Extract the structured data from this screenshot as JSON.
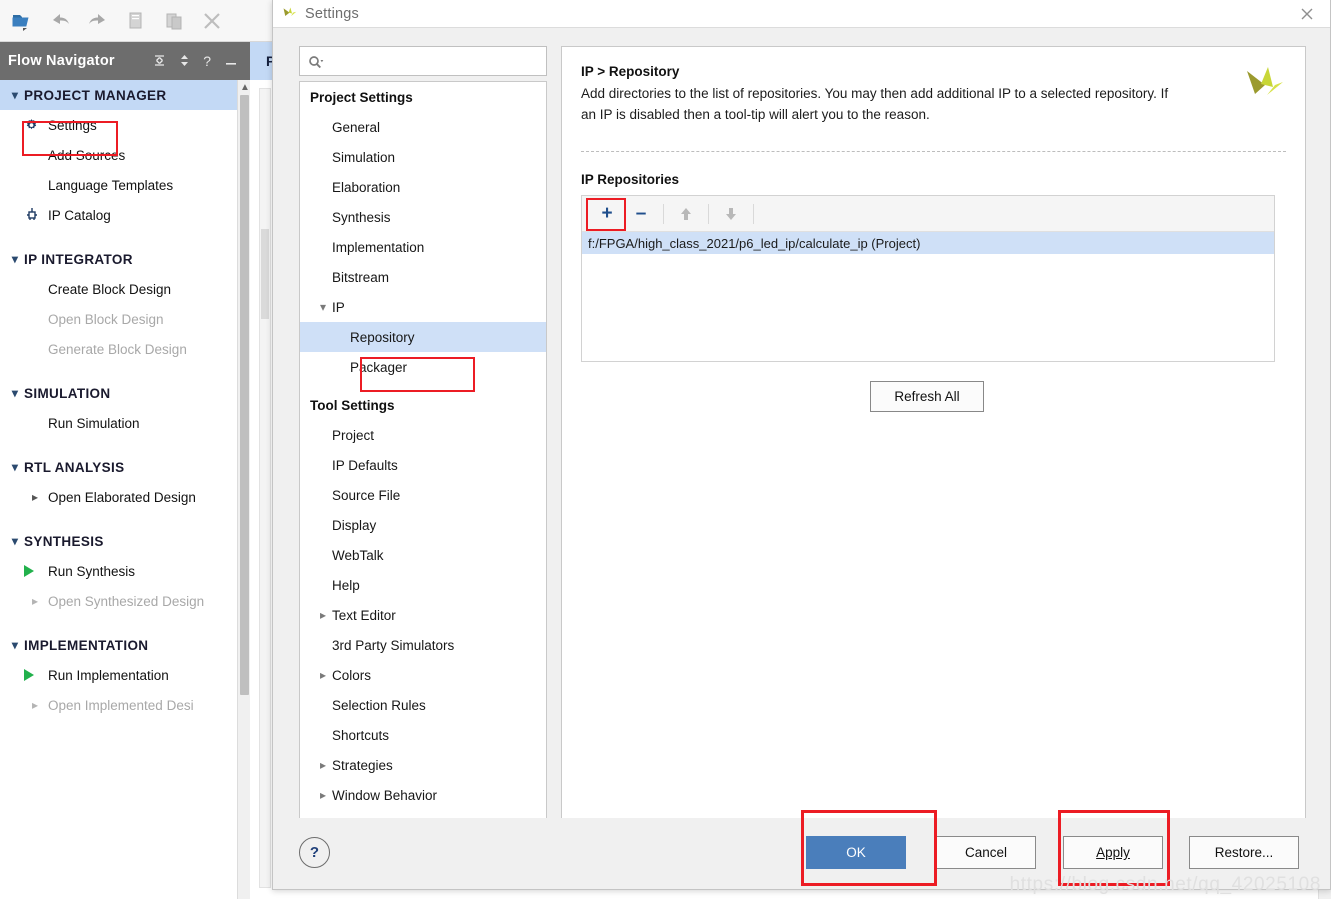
{
  "background": {
    "toolbar_icons": [
      "open-folder-icon",
      "undo-icon",
      "redo-icon",
      "copy-icon",
      "paste-icon",
      "close-icon"
    ],
    "flow_navigator": {
      "title": "Flow Navigator",
      "tools": [
        "collapse-all-icon",
        "expand-icon",
        "help-icon",
        "minimize-icon"
      ],
      "groups": [
        {
          "label": "PROJECT MANAGER",
          "active": true,
          "items": [
            {
              "label": "Settings",
              "icon": "gear-icon",
              "dim": false,
              "highlighted": true
            },
            {
              "label": "Add Sources",
              "icon": "",
              "dim": false
            },
            {
              "label": "Language Templates",
              "icon": "",
              "dim": false
            },
            {
              "label": "IP Catalog",
              "icon": "ip-catalog-icon",
              "dim": false
            }
          ]
        },
        {
          "label": "IP INTEGRATOR",
          "active": false,
          "items": [
            {
              "label": "Create Block Design",
              "icon": "",
              "dim": false
            },
            {
              "label": "Open Block Design",
              "icon": "",
              "dim": true
            },
            {
              "label": "Generate Block Design",
              "icon": "",
              "dim": true
            }
          ]
        },
        {
          "label": "SIMULATION",
          "active": false,
          "items": [
            {
              "label": "Run Simulation",
              "icon": "",
              "dim": false
            }
          ]
        },
        {
          "label": "RTL ANALYSIS",
          "active": false,
          "items": [
            {
              "label": "Open Elaborated Design",
              "icon": "chevron-right-icon",
              "dim": false,
              "arrow": true
            }
          ]
        },
        {
          "label": "SYNTHESIS",
          "active": false,
          "items": [
            {
              "label": "Run Synthesis",
              "icon": "play-icon",
              "dim": false
            },
            {
              "label": "Open Synthesized Design",
              "icon": "chevron-right-icon",
              "dim": true,
              "arrow": true
            }
          ]
        },
        {
          "label": "IMPLEMENTATION",
          "active": false,
          "items": [
            {
              "label": "Run Implementation",
              "icon": "play-icon",
              "dim": false
            },
            {
              "label": "Open Implemented Desi",
              "icon": "chevron-right-icon",
              "dim": true,
              "arrow": true
            }
          ]
        }
      ]
    },
    "panel_header_label": "P"
  },
  "dialog": {
    "title": "Settings",
    "icon": "vivado-logo-icon",
    "close_icon": "close-icon",
    "search": {
      "placeholder": "",
      "value": "",
      "icon": "search-icon"
    },
    "nav": {
      "sections": [
        {
          "header": "Project Settings",
          "items": [
            {
              "label": "General",
              "level": 1,
              "twisty": ""
            },
            {
              "label": "Simulation",
              "level": 1,
              "twisty": ""
            },
            {
              "label": "Elaboration",
              "level": 1,
              "twisty": ""
            },
            {
              "label": "Synthesis",
              "level": 1,
              "twisty": ""
            },
            {
              "label": "Implementation",
              "level": 1,
              "twisty": ""
            },
            {
              "label": "Bitstream",
              "level": 1,
              "twisty": ""
            },
            {
              "label": "IP",
              "level": 1,
              "twisty": "expanded"
            },
            {
              "label": "Repository",
              "level": 2,
              "twisty": "",
              "selected": true,
              "highlighted": true
            },
            {
              "label": "Packager",
              "level": 2,
              "twisty": ""
            }
          ]
        },
        {
          "header": "Tool Settings",
          "items": [
            {
              "label": "Project",
              "level": 1,
              "twisty": ""
            },
            {
              "label": "IP Defaults",
              "level": 1,
              "twisty": ""
            },
            {
              "label": "Source File",
              "level": 1,
              "twisty": ""
            },
            {
              "label": "Display",
              "level": 1,
              "twisty": ""
            },
            {
              "label": "WebTalk",
              "level": 1,
              "twisty": ""
            },
            {
              "label": "Help",
              "level": 1,
              "twisty": ""
            },
            {
              "label": "Text Editor",
              "level": 1,
              "twisty": "collapsed"
            },
            {
              "label": "3rd Party Simulators",
              "level": 1,
              "twisty": ""
            },
            {
              "label": "Colors",
              "level": 1,
              "twisty": "collapsed"
            },
            {
              "label": "Selection Rules",
              "level": 1,
              "twisty": ""
            },
            {
              "label": "Shortcuts",
              "level": 1,
              "twisty": ""
            },
            {
              "label": "Strategies",
              "level": 1,
              "twisty": "collapsed"
            },
            {
              "label": "Window Behavior",
              "level": 1,
              "twisty": "collapsed"
            }
          ]
        }
      ]
    },
    "content": {
      "breadcrumb": "IP > Repository",
      "description": "Add directories to the list of repositories. You may then add additional IP to a selected repository. If an IP is disabled then a tool-tip will alert you to the reason.",
      "repositories_label": "IP Repositories",
      "toolbar": {
        "add_label": "+",
        "remove_label": "–",
        "move_up_icon": "arrow-up-icon",
        "move_down_icon": "arrow-down-icon"
      },
      "repositories": [
        {
          "path": "f:/FPGA/high_class_2021/p6_led_ip/calculate_ip (Project)",
          "selected": true
        }
      ],
      "refresh_label": "Refresh All"
    },
    "footer": {
      "help_label": "?",
      "ok_label": "OK",
      "cancel_label": "Cancel",
      "apply_label": "Apply",
      "restore_label": "Restore..."
    }
  },
  "watermark": "https://blog.csdn.net/qq_42025108",
  "colors": {
    "accent_blue": "#4a7ebb",
    "selection_blue": "#cfe0f7",
    "highlight_red": "#ec1c24",
    "nav_header_gray": "#6d6d6d",
    "green_play": "#22b14c"
  }
}
